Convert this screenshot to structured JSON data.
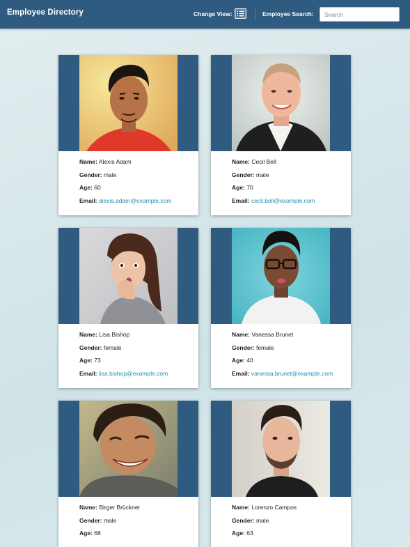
{
  "header": {
    "title": "Employee Directory",
    "change_view_label": "Change View:",
    "change_view_icon": "list-view-icon",
    "search_label": "Employee Search:",
    "search_placeholder": "Search",
    "search_value": ""
  },
  "labels": {
    "name": "Name:",
    "gender": "Gender:",
    "age": "Age:",
    "email": "Email:"
  },
  "colors": {
    "header_bg": "#2f5b80",
    "card_band": "#2f5b80",
    "link": "#1f8fb3"
  },
  "employees": [
    {
      "name": "Alexis Adam",
      "gender": "male",
      "age": "60",
      "email": "alexis.adam@example.com"
    },
    {
      "name": "Cecil Bell",
      "gender": "male",
      "age": "70",
      "email": "cecil.bell@example.com"
    },
    {
      "name": "Lisa Bishop",
      "gender": "female",
      "age": "73",
      "email": "lisa.bishop@example.com"
    },
    {
      "name": "Vanessa Brunet",
      "gender": "female",
      "age": "40",
      "email": "vanessa.brunet@example.com"
    },
    {
      "name": "Birger Brückner",
      "gender": "male",
      "age": "68",
      "email": ""
    },
    {
      "name": "Lorenzo Campos",
      "gender": "male",
      "age": "63",
      "email": ""
    }
  ]
}
